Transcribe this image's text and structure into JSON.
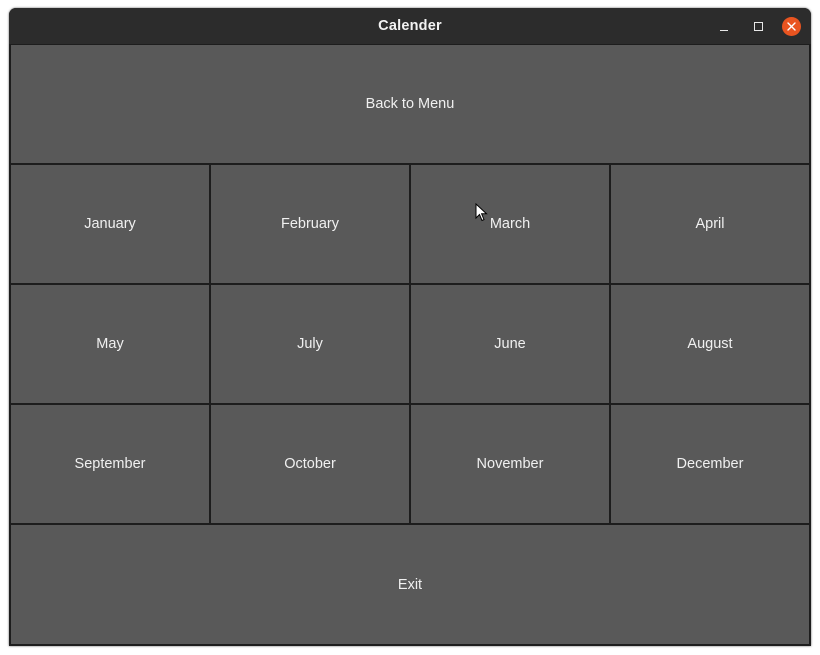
{
  "window": {
    "title": "Calender"
  },
  "title_controls": {
    "minimize_icon": "minimize-icon",
    "maximize_icon": "maximize-icon",
    "close_icon": "close-icon",
    "close_color": "#e95420"
  },
  "back_button": {
    "label": "Back to Menu"
  },
  "months": [
    {
      "label": "January"
    },
    {
      "label": "February"
    },
    {
      "label": "March"
    },
    {
      "label": "April"
    },
    {
      "label": "May"
    },
    {
      "label": "July"
    },
    {
      "label": "June"
    },
    {
      "label": "August"
    },
    {
      "label": "September"
    },
    {
      "label": "October"
    },
    {
      "label": "November"
    },
    {
      "label": "December"
    }
  ],
  "exit_button": {
    "label": "Exit"
  },
  "colors": {
    "button_bg": "#595959",
    "titlebar_bg": "#2c2c2c",
    "text": "#f0f0f0"
  }
}
